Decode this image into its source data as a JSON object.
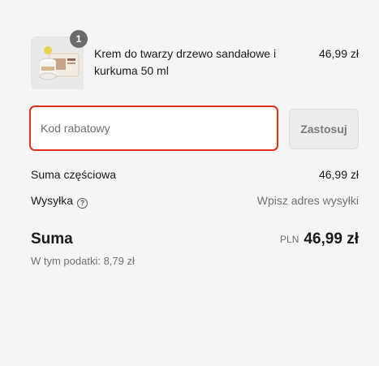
{
  "product": {
    "quantity": "1",
    "name": "Krem do twarzy drzewo sandałowe i kurkuma 50 ml",
    "price": "46,99 zł"
  },
  "discount": {
    "placeholder": "Kod rabatowy",
    "apply_label": "Zastosuj"
  },
  "summary": {
    "subtotal_label": "Suma częściowa",
    "subtotal_value": "46,99 zł",
    "shipping_label": "Wysyłka",
    "shipping_help_icon": "question-circle-icon",
    "shipping_value": "Wpisz adres wysyłki",
    "total_label": "Suma",
    "total_currency": "PLN",
    "total_value": "46,99 zł",
    "tax_text": "W tym podatki: 8,79 zł"
  },
  "colors": {
    "background": "#f5f5f5",
    "input_focus_border": "#e0301e",
    "muted_text": "#707070"
  }
}
